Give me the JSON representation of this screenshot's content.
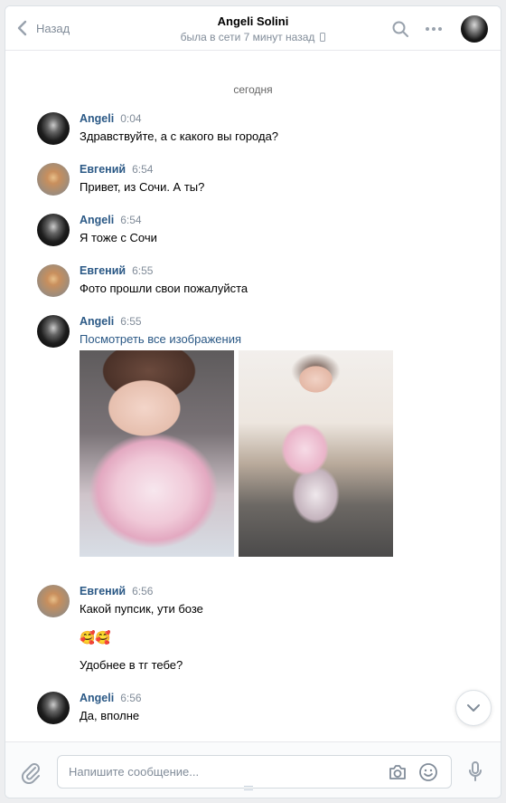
{
  "header": {
    "back_label": "Назад",
    "title": "Angeli Solini",
    "status": "была в сети 7 минут назад"
  },
  "date_separator": "сегодня",
  "messages": [
    {
      "author": "Angeli",
      "time": "0:04",
      "lines": [
        "Здравствуйте, а с какого вы города?"
      ]
    },
    {
      "author": "Евгений",
      "time": "6:54",
      "lines": [
        "Привет, из Сочи. А ты?"
      ]
    },
    {
      "author": "Angeli",
      "time": "6:54",
      "lines": [
        "Я тоже с Сочи"
      ]
    },
    {
      "author": "Евгений",
      "time": "6:55",
      "lines": [
        "Фото прошли свои пожалуйста"
      ]
    },
    {
      "author": "Angeli",
      "time": "6:55",
      "link": "Посмотреть все изображения"
    },
    {
      "author": "Евгений",
      "time": "6:56",
      "lines": [
        "Какой пупсик, ути бозе",
        "🥰🥰",
        "Удобнее в тг тебе?"
      ]
    },
    {
      "author": "Angeli",
      "time": "6:56",
      "lines": [
        "Да, вполне"
      ]
    }
  ],
  "composer": {
    "placeholder": "Напишите сообщение..."
  },
  "icons": {
    "back": "chevron-left-icon",
    "search": "search-icon",
    "more": "more-dots-icon",
    "phone": "mobile-phone-icon",
    "scroll": "chevron-down-icon",
    "attach": "paperclip-icon",
    "camera": "camera-icon",
    "emoji": "smile-icon",
    "mic": "microphone-icon"
  },
  "colors": {
    "accent": "#2a5885",
    "muted": "#818c99",
    "background": "#edeef0"
  }
}
